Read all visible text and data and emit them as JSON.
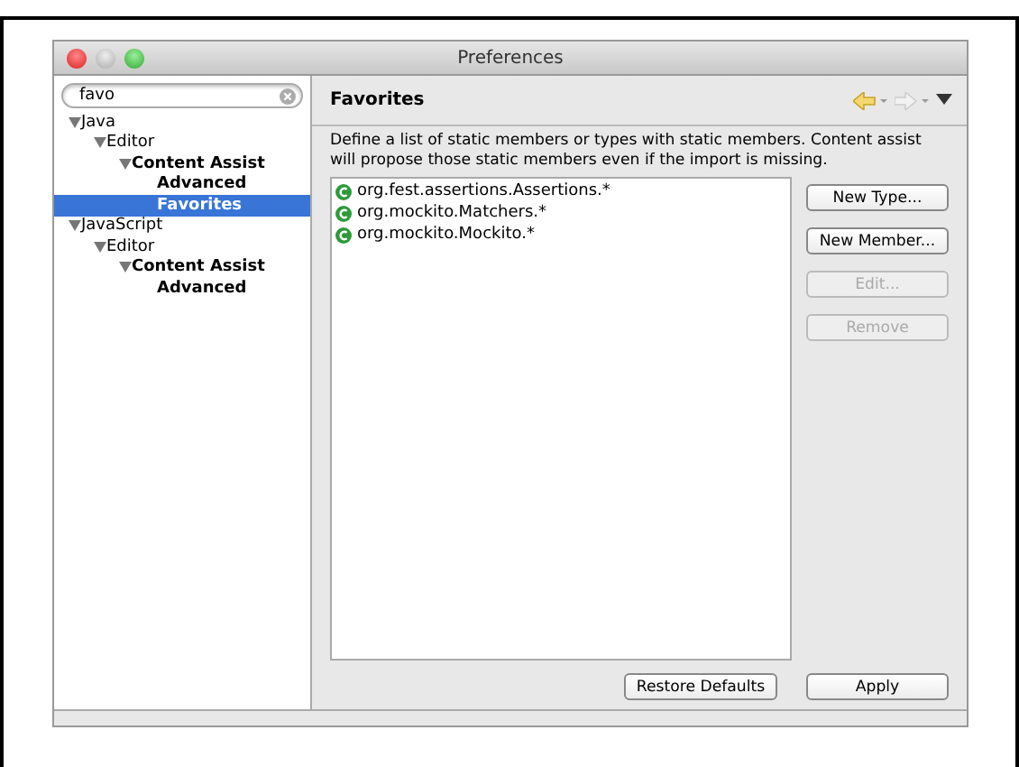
{
  "window": {
    "title": "Preferences"
  },
  "search": {
    "value": "favo"
  },
  "tree": [
    {
      "label": "Java",
      "expanded": true,
      "bold": false,
      "selected": false,
      "children": [
        {
          "label": "Editor",
          "expanded": true,
          "bold": false,
          "selected": false,
          "children": [
            {
              "label": "Content Assist",
              "expanded": true,
              "bold": true,
              "selected": false,
              "children": [
                {
                  "label": "Advanced",
                  "bold": true,
                  "selected": false
                },
                {
                  "label": "Favorites",
                  "bold": true,
                  "selected": true
                }
              ]
            }
          ]
        }
      ]
    },
    {
      "label": "JavaScript",
      "expanded": true,
      "bold": false,
      "selected": false,
      "children": [
        {
          "label": "Editor",
          "expanded": true,
          "bold": false,
          "selected": false,
          "children": [
            {
              "label": "Content Assist",
              "expanded": true,
              "bold": true,
              "selected": false,
              "children": [
                {
                  "label": "Advanced",
                  "bold": true,
                  "selected": false
                }
              ]
            }
          ]
        }
      ]
    }
  ],
  "page": {
    "title": "Favorites",
    "description": "Define a list of static members or types with static members. Content assist will propose those static members even if the import is missing.",
    "back_disabled": false,
    "forward_disabled": true
  },
  "favorites": [
    "org.fest.assertions.Assertions.*",
    "org.mockito.Matchers.*",
    "org.mockito.Mockito.*"
  ],
  "side_buttons": [
    {
      "label": "New Type...",
      "disabled": false
    },
    {
      "label": "New Member...",
      "disabled": false
    },
    {
      "label": "Edit...",
      "disabled": true
    },
    {
      "label": "Remove",
      "disabled": true
    }
  ],
  "bottom_buttons": [
    "Restore Defaults",
    "Apply"
  ]
}
